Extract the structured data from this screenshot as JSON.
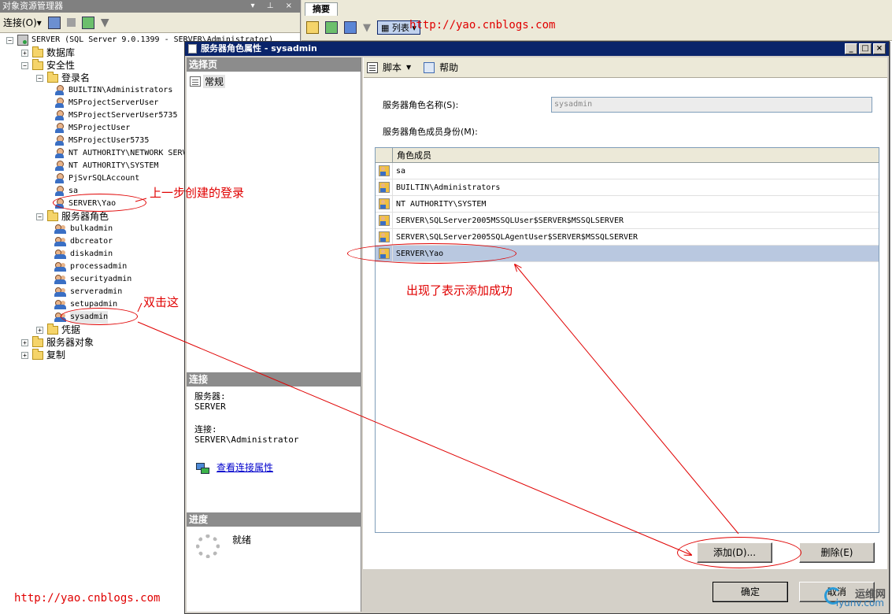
{
  "object_explorer": {
    "title": "对象资源管理器",
    "title_controls": "▾ ⊥ ×",
    "connect_label": "连接(O)▾",
    "tree": [
      {
        "text": "SERVER (SQL Server 9.0.1399 - SERVER\\Administrator)",
        "kind": "server",
        "expander": "−"
      },
      {
        "text": "数据库",
        "kind": "folder",
        "expander": "+"
      },
      {
        "text": "安全性",
        "kind": "folder",
        "expander": "−"
      },
      {
        "text": "登录名",
        "kind": "folder",
        "expander": "−"
      },
      {
        "text": "BUILTIN\\Administrators",
        "kind": "login"
      },
      {
        "text": "MSProjectServerUser",
        "kind": "login"
      },
      {
        "text": "MSProjectServerUser5735",
        "kind": "login"
      },
      {
        "text": "MSProjectUser",
        "kind": "login"
      },
      {
        "text": "MSProjectUser5735",
        "kind": "login"
      },
      {
        "text": "NT AUTHORITY\\NETWORK SERVICE",
        "kind": "login"
      },
      {
        "text": "NT AUTHORITY\\SYSTEM",
        "kind": "login"
      },
      {
        "text": "PjSvrSQLAccount",
        "kind": "login"
      },
      {
        "text": "sa",
        "kind": "login"
      },
      {
        "text": "SERVER\\Yao",
        "kind": "login"
      },
      {
        "text": "服务器角色",
        "kind": "folder",
        "expander": "−"
      },
      {
        "text": "bulkadmin",
        "kind": "role"
      },
      {
        "text": "dbcreator",
        "kind": "role"
      },
      {
        "text": "diskadmin",
        "kind": "role"
      },
      {
        "text": "processadmin",
        "kind": "role"
      },
      {
        "text": "securityadmin",
        "kind": "role"
      },
      {
        "text": "serveradmin",
        "kind": "role"
      },
      {
        "text": "setupadmin",
        "kind": "role"
      },
      {
        "text": "sysadmin",
        "kind": "role"
      },
      {
        "text": "凭据",
        "kind": "folder",
        "expander": "+"
      },
      {
        "text": "服务器对象",
        "kind": "folder",
        "expander": "+"
      },
      {
        "text": "复制",
        "kind": "folder",
        "expander": "+"
      }
    ]
  },
  "summary_pane": {
    "tab": "摘要",
    "list_label": "列表"
  },
  "dialog": {
    "title": "服务器角色属性 - sysadmin",
    "window_buttons": [
      "_",
      "□",
      "×"
    ],
    "select_page_header": "选择页",
    "pages": [
      "常规"
    ],
    "connection_header": "连接",
    "server_label": "服务器:",
    "server_value": "SERVER",
    "connection_label": "连接:",
    "connection_value": "SERVER\\Administrator",
    "view_conn_props": "查看连接属性",
    "progress_header": "进度",
    "progress_status": "就绪",
    "toolbar_script": "脚本",
    "toolbar_help": "帮助",
    "role_name_label": "服务器角色名称(S):",
    "role_name_value": "sysadmin",
    "members_label": "服务器角色成员身份(M):",
    "grid_header": "角色成员",
    "members": [
      "sa",
      "BUILTIN\\Administrators",
      "NT AUTHORITY\\SYSTEM",
      "SERVER\\SQLServer2005MSSQLUser$SERVER$MSSQLSERVER",
      "SERVER\\SQLServer2005SQLAgentUser$SERVER$MSSQLSERVER",
      "SERVER\\Yao"
    ],
    "selected_member": "SERVER\\Yao",
    "add_button": "添加(D)...",
    "remove_button": "删除(E)",
    "ok_button": "确定",
    "cancel_button": "取消"
  },
  "annotations": {
    "created_login": "上一步创建的登录",
    "double_click": "双击这",
    "added_success": "出现了表示添加成功",
    "url_top": "http://yao.cnblogs.com",
    "url_bottom": "http://yao.cnblogs.com",
    "color": "#e00000"
  },
  "watermark": {
    "line1": "运维网",
    "line2": "iyunv.com"
  }
}
